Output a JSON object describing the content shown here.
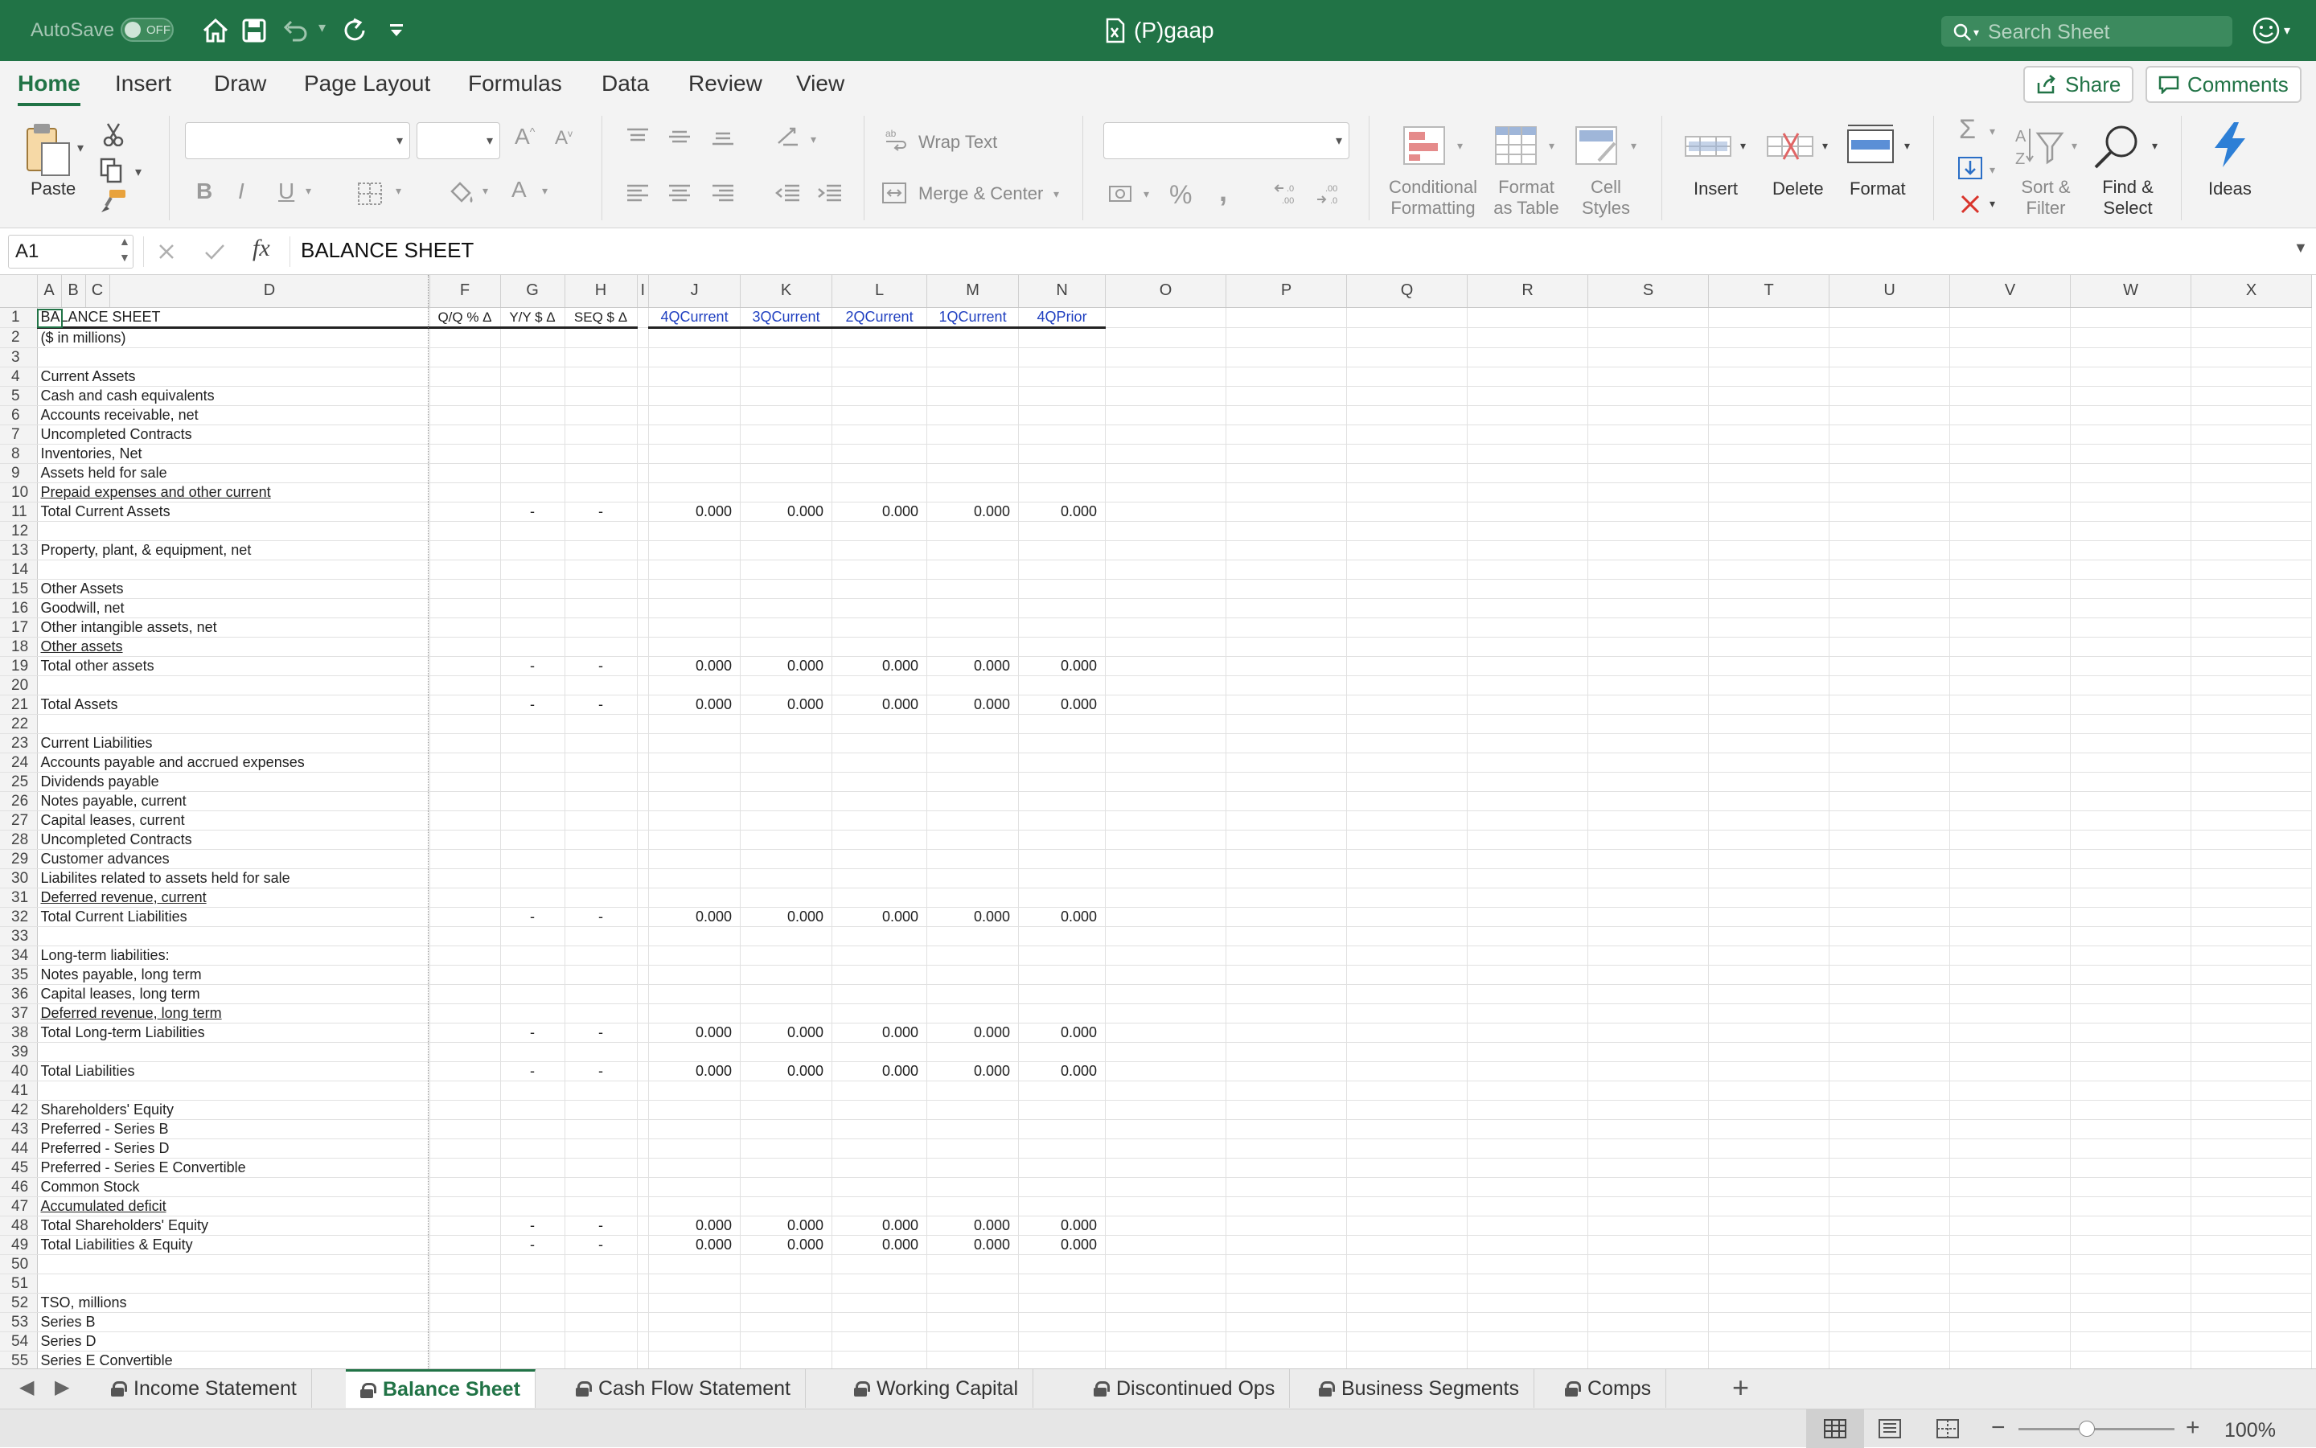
{
  "titlebar": {
    "autosave_label": "AutoSave",
    "autosave_state": "OFF",
    "document_title": "(P)gaap",
    "search_placeholder": "Search Sheet"
  },
  "ribbon_tabs": [
    "Home",
    "Insert",
    "Draw",
    "Page Layout",
    "Formulas",
    "Data",
    "Review",
    "View"
  ],
  "ribbon_actions": {
    "share": "Share",
    "comments": "Comments"
  },
  "ribbon": {
    "paste": "Paste",
    "wrap_text": "Wrap Text",
    "merge_center": "Merge & Center",
    "conditional_formatting": [
      "Conditional",
      "Formatting"
    ],
    "format_as_table": [
      "Format",
      "as Table"
    ],
    "cell_styles": [
      "Cell",
      "Styles"
    ],
    "insert": "Insert",
    "delete": "Delete",
    "format": "Format",
    "sort_filter": [
      "Sort &",
      "Filter"
    ],
    "find_select": [
      "Find &",
      "Select"
    ],
    "ideas": "Ideas"
  },
  "formula_bar": {
    "name_box": "A1",
    "fx": "fx",
    "content": "BALANCE SHEET"
  },
  "columns": [
    "A",
    "B",
    "C",
    "D",
    "F",
    "G",
    "H",
    "I",
    "J",
    "K",
    "L",
    "M",
    "N",
    "O",
    "P",
    "Q",
    "R",
    "S",
    "T",
    "U",
    "V",
    "W",
    "X"
  ],
  "header_row": {
    "label": "BALANCE SHEET",
    "deltas": [
      "Q/Q % Δ",
      "Y/Y $ Δ",
      "SEQ $ Δ"
    ],
    "periods": [
      "4QCurrent",
      "3QCurrent",
      "2QCurrent",
      "1QCurrent",
      "4QPrior"
    ]
  },
  "rows": [
    {
      "n": "2",
      "label": "($ in millions)"
    },
    {
      "n": "3",
      "label": ""
    },
    {
      "n": "4",
      "label": "Current Assets"
    },
    {
      "n": "5",
      "label": "Cash and cash equivalents"
    },
    {
      "n": "6",
      "label": "Accounts receivable, net"
    },
    {
      "n": "7",
      "label": "Uncompleted Contracts"
    },
    {
      "n": "8",
      "label": "Inventories, Net"
    },
    {
      "n": "9",
      "label": "Assets held for sale"
    },
    {
      "n": "10",
      "label": "Prepaid expenses and other current",
      "u": true
    },
    {
      "n": "11",
      "label": "Total Current Assets",
      "total": true
    },
    {
      "n": "12",
      "label": ""
    },
    {
      "n": "13",
      "label": "Property, plant, & equipment, net"
    },
    {
      "n": "14",
      "label": ""
    },
    {
      "n": "15",
      "label": "Other Assets"
    },
    {
      "n": "16",
      "label": "Goodwill, net"
    },
    {
      "n": "17",
      "label": "Other intangible assets, net"
    },
    {
      "n": "18",
      "label": "Other assets",
      "u": true
    },
    {
      "n": "19",
      "label": "Total other assets",
      "total": true
    },
    {
      "n": "20",
      "label": ""
    },
    {
      "n": "21",
      "label": "Total Assets",
      "total": true
    },
    {
      "n": "22",
      "label": ""
    },
    {
      "n": "23",
      "label": "Current Liabilities"
    },
    {
      "n": "24",
      "label": "Accounts payable and accrued expenses"
    },
    {
      "n": "25",
      "label": "Dividends payable"
    },
    {
      "n": "26",
      "label": "Notes payable, current"
    },
    {
      "n": "27",
      "label": "Capital leases, current"
    },
    {
      "n": "28",
      "label": "Uncompleted Contracts"
    },
    {
      "n": "29",
      "label": "Customer advances"
    },
    {
      "n": "30",
      "label": "Liabilites related to assets held for sale"
    },
    {
      "n": "31",
      "label": "Deferred revenue, current",
      "u": true
    },
    {
      "n": "32",
      "label": "Total Current Liabilities",
      "total": true
    },
    {
      "n": "33",
      "label": ""
    },
    {
      "n": "34",
      "label": "Long-term liabilities:"
    },
    {
      "n": "35",
      "label": "Notes payable, long term"
    },
    {
      "n": "36",
      "label": "Capital leases, long term"
    },
    {
      "n": "37",
      "label": "Deferred revenue, long term",
      "u": true
    },
    {
      "n": "38",
      "label": "Total Long-term Liabilities",
      "total": true
    },
    {
      "n": "39",
      "label": ""
    },
    {
      "n": "40",
      "label": "Total Liabilities",
      "total": true
    },
    {
      "n": "41",
      "label": ""
    },
    {
      "n": "42",
      "label": "Shareholders' Equity"
    },
    {
      "n": "43",
      "label": "Preferred - Series B"
    },
    {
      "n": "44",
      "label": "Preferred - Series D"
    },
    {
      "n": "45",
      "label": "Preferred - Series E Convertible"
    },
    {
      "n": "46",
      "label": "Common Stock"
    },
    {
      "n": "47",
      "label": "Accumulated deficit",
      "u": true
    },
    {
      "n": "48",
      "label": "Total Shareholders' Equity",
      "total": true
    },
    {
      "n": "49",
      "label": "Total Liabilities & Equity",
      "total": true
    },
    {
      "n": "50",
      "label": ""
    },
    {
      "n": "51",
      "label": ""
    },
    {
      "n": "52",
      "label": "TSO, millions"
    },
    {
      "n": "53",
      "label": "Series B"
    },
    {
      "n": "54",
      "label": "Series D"
    },
    {
      "n": "55",
      "label": "Series E Convertible"
    }
  ],
  "total_values": {
    "dash": "-",
    "zero": "0.000"
  },
  "sheet_tabs": [
    "Income Statement",
    "Balance Sheet",
    "Cash Flow Statement",
    "Working Capital",
    "Discontinued Ops",
    "Business Segments",
    "Comps"
  ],
  "active_sheet": "Balance Sheet",
  "status": {
    "zoom": "100%",
    "zoom_level_percent": 100
  }
}
